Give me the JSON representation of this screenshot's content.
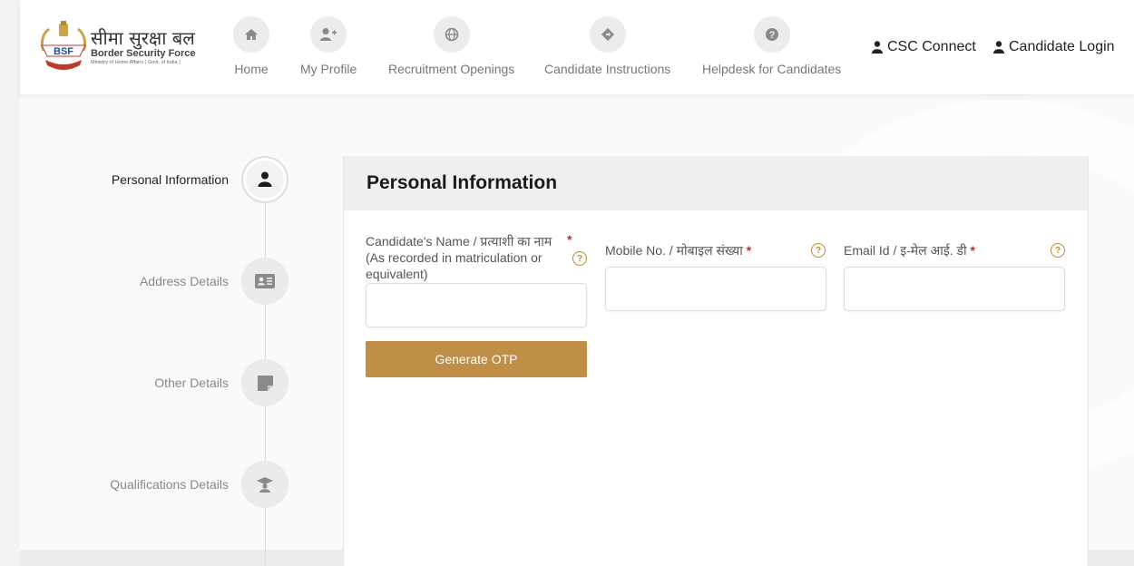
{
  "brand": {
    "emblem_text": "BSF",
    "hindi_name": "सीमा सुरक्षा बल",
    "english_name": "Border Security Force",
    "ministry": "Ministry of Home Affairs ( Govt. of India )"
  },
  "nav": {
    "home": "Home",
    "my_profile": "My Profile",
    "recruitment_openings": "Recruitment Openings",
    "candidate_instructions": "Candidate Instructions",
    "helpdesk": "Helpdesk for Candidates"
  },
  "header_links": {
    "csc_connect": "CSC Connect",
    "candidate_login": "Candidate Login"
  },
  "steps": [
    {
      "label": "Personal Information",
      "icon": "user-icon",
      "active": true
    },
    {
      "label": "Address Details",
      "icon": "id-card-icon",
      "active": false
    },
    {
      "label": "Other Details",
      "icon": "note-icon",
      "active": false
    },
    {
      "label": "Qualifications Details",
      "icon": "graduation-cap-icon",
      "active": false
    }
  ],
  "form": {
    "title": "Personal Information",
    "name_label": "Candidate's Name / प्रत्याशी का नाम",
    "name_note_line1": "(As recorded in matriculation or",
    "name_note_line2": "equivalent)",
    "mobile_label": "Mobile No. / मोबाइल संख्या",
    "email_label": "Email Id / इ-मेल आई. डी",
    "required_mark": "*",
    "help_mark": "?",
    "name_value": "",
    "mobile_value": "",
    "email_value": "",
    "generate_otp": "Generate OTP"
  },
  "colors": {
    "accent": "#bf8f47",
    "required": "#c62828",
    "help": "#c08a2c"
  }
}
